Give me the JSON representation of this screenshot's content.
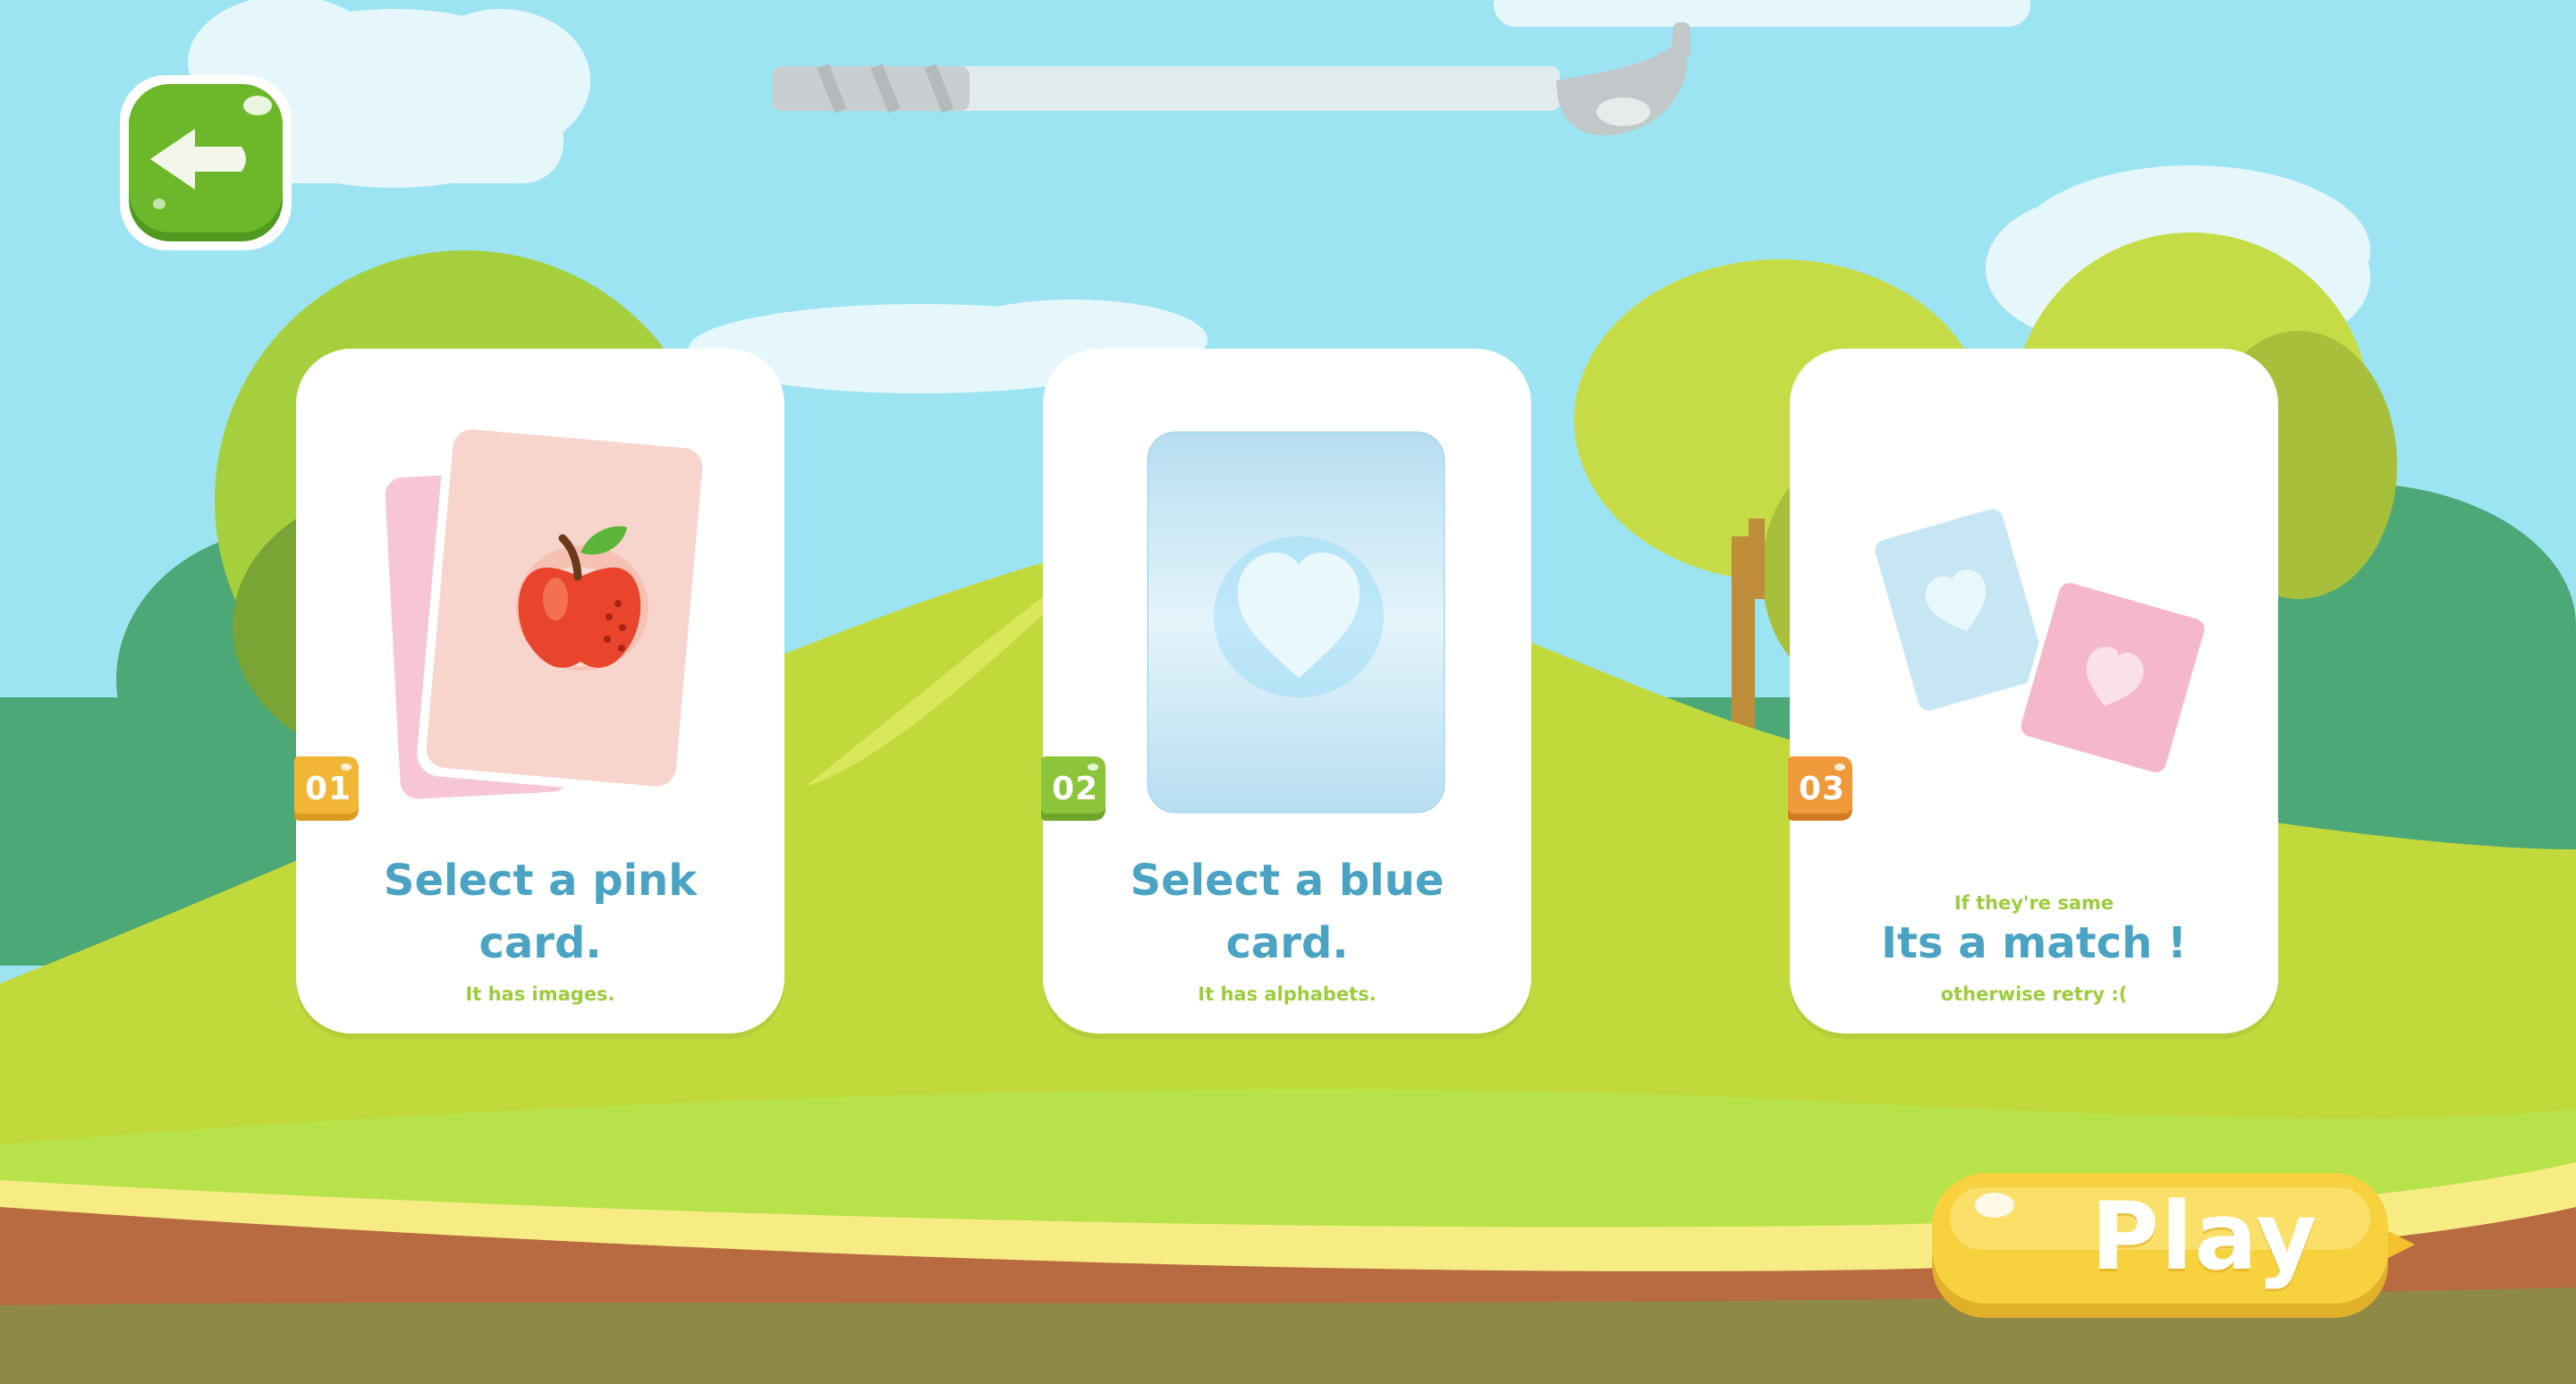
{
  "game": {
    "back_button": {
      "icon": "arrow-left-icon",
      "color": "#6cb82a"
    },
    "meter": {
      "icon": "spoon-icon"
    },
    "steps": [
      {
        "number": "01",
        "badge_color": "#f2b637",
        "title_line1": "Select a pink",
        "title_line2": "card.",
        "subtitle": "It has images.",
        "illustration": "apple-card-icon"
      },
      {
        "number": "02",
        "badge_color": "#8cc43a",
        "title_line1": "Select a blue",
        "title_line2": "card.",
        "subtitle": "It has alphabets.",
        "illustration": "heart-card-icon"
      },
      {
        "number": "03",
        "badge_color": "#ef9a3a",
        "title_pre": "If they're same",
        "title": "Its a match !",
        "subtitle": "otherwise retry :(",
        "illustration": "matching-cards-icon"
      }
    ],
    "play_button": {
      "label": "Play",
      "color": "#f7d23e"
    }
  },
  "colors": {
    "sky": "#9de4f2",
    "title_text": "#4aa3c3",
    "subtitle_text": "#9ccc3c"
  }
}
